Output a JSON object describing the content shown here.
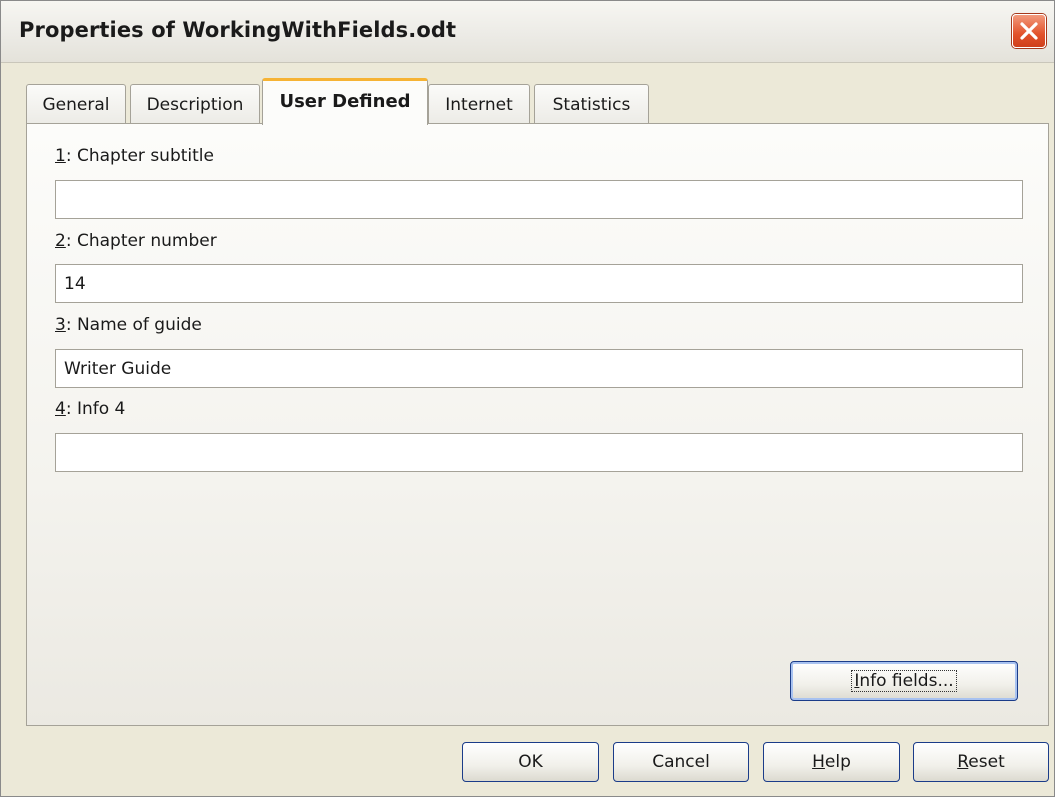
{
  "window": {
    "title": "Properties of WorkingWithFields.odt",
    "close_icon": "close-icon"
  },
  "tabs": [
    {
      "label": "General",
      "active": false
    },
    {
      "label": "Description",
      "active": false
    },
    {
      "label": "User Defined",
      "active": true
    },
    {
      "label": "Internet",
      "active": false
    },
    {
      "label": "Statistics",
      "active": false
    }
  ],
  "fields": [
    {
      "number": "1",
      "label_rest": ": Chapter subtitle",
      "value": ""
    },
    {
      "number": "2",
      "label_rest": ": Chapter number",
      "value": "14"
    },
    {
      "number": "3",
      "label_rest": ": Name of guide",
      "value": "Writer Guide"
    },
    {
      "number": "4",
      "label_rest": ": Info 4",
      "value": ""
    }
  ],
  "info_button": {
    "mnemonic": "I",
    "rest": "nfo fields..."
  },
  "buttons": {
    "ok": "OK",
    "cancel": "Cancel",
    "help_mnemonic": "H",
    "help_rest": "elp",
    "reset_mnemonic": "R",
    "reset_rest": "eset"
  }
}
